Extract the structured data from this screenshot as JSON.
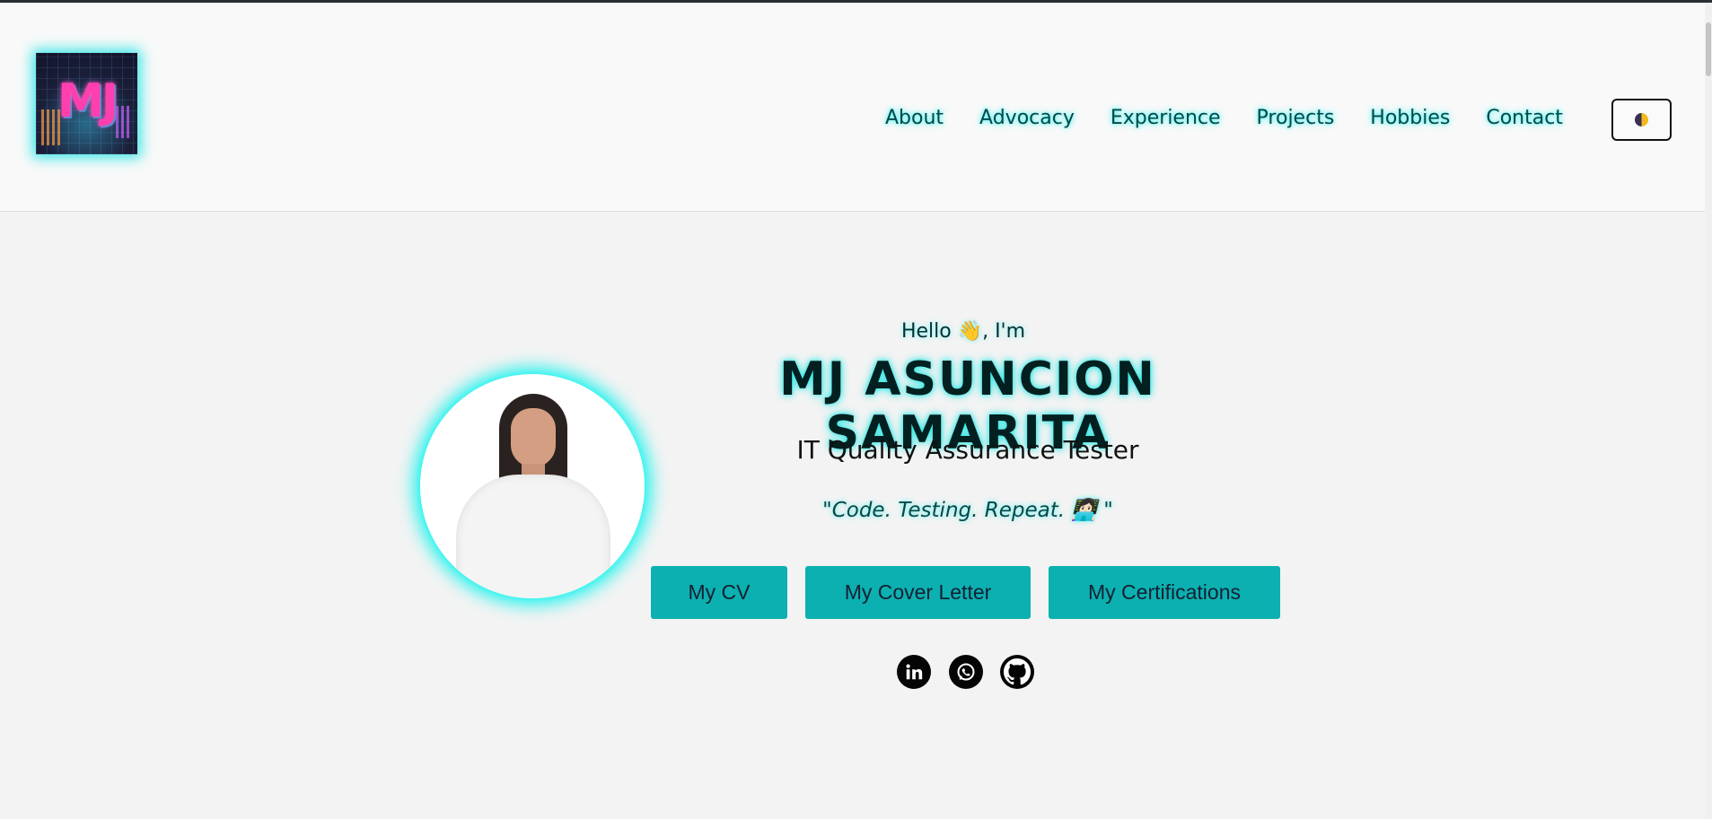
{
  "header": {
    "logo_text": "MJ",
    "nav": [
      "About",
      "Advocacy",
      "Experience",
      "Projects",
      "Hobbies",
      "Contact"
    ],
    "theme_toggle_icon": "half-moon-icon"
  },
  "hero": {
    "greeting": "Hello 👋, I'm",
    "name": "MJ ASUNCION SAMARITA",
    "role": "IT Quality Assurance Tester",
    "quote": "\"Code. Testing. Repeat. 👩🏻‍💻 \"",
    "buttons": {
      "cv": "My CV",
      "cover_letter": "My Cover Letter",
      "certifications": "My Certifications"
    },
    "socials": [
      "linkedin-icon",
      "whatsapp-icon",
      "github-icon"
    ]
  },
  "colors": {
    "accent": "#0cb0b0",
    "glow": "#2ff3ee",
    "background": "#f3f3f3"
  }
}
